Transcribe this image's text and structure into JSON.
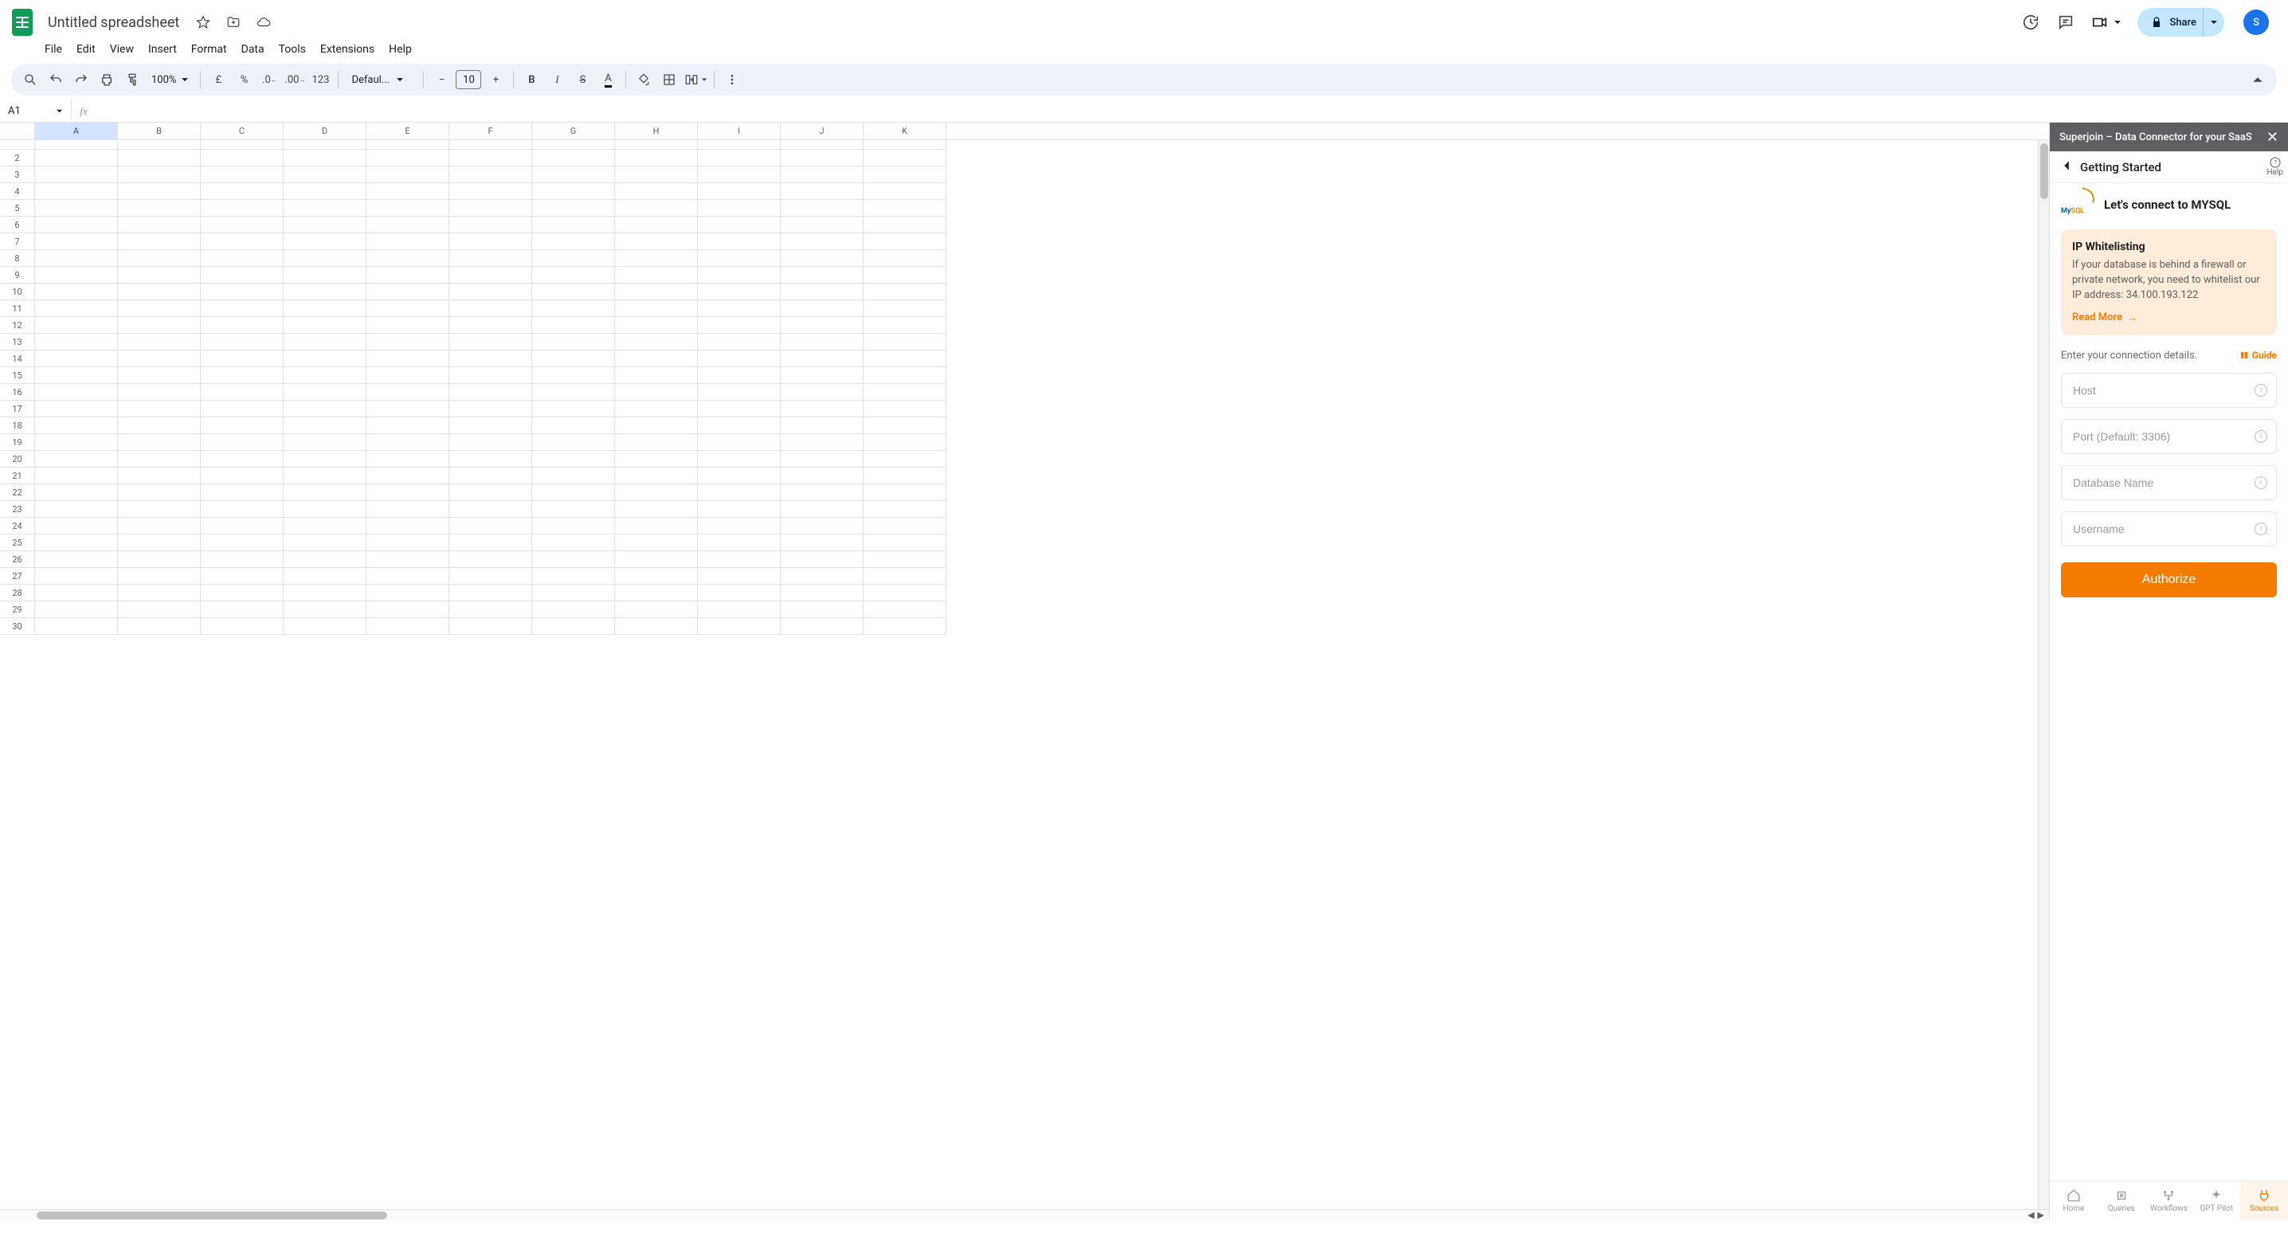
{
  "header": {
    "doc_title": "Untitled spreadsheet",
    "share_label": "Share",
    "avatar_letter": "S"
  },
  "menus": [
    "File",
    "Edit",
    "View",
    "Insert",
    "Format",
    "Data",
    "Tools",
    "Extensions",
    "Help"
  ],
  "toolbar": {
    "zoom": "100%",
    "currency": "£",
    "percent": "%",
    "dec_dec": ".0",
    "inc_dec": ".00",
    "num_fmt": "123",
    "font": "Defaul...",
    "font_size": "10"
  },
  "namebox": {
    "cell": "A1"
  },
  "grid": {
    "columns": [
      "A",
      "B",
      "C",
      "D",
      "E",
      "F",
      "G",
      "H",
      "I",
      "J",
      "K"
    ],
    "selected_col": "A",
    "row_start": 2,
    "row_end": 30
  },
  "sidepanel": {
    "titlebar": "Superjoin – Data Connector for your SaaS",
    "header": "Getting Started",
    "help_label": "Help",
    "mysql_label": "MySQL",
    "connect_title": "Let's connect to MYSQL",
    "ip_card": {
      "title": "IP Whitelisting",
      "text": "If your database is behind a firewall or private network, you need to whitelist our IP address: 34.100.193.122",
      "read_more": "Read More"
    },
    "details_label": "Enter your connection details.",
    "guide_label": "Guide",
    "fields": {
      "host": "Host",
      "port": "Port (Default: 3306)",
      "db": "Database Name",
      "user": "Username"
    },
    "authorize": "Authorize",
    "nav": {
      "home": "Home",
      "queries": "Queries",
      "workflows": "Workflows",
      "gpt": "GPT Pilot",
      "sources": "Sources"
    }
  }
}
